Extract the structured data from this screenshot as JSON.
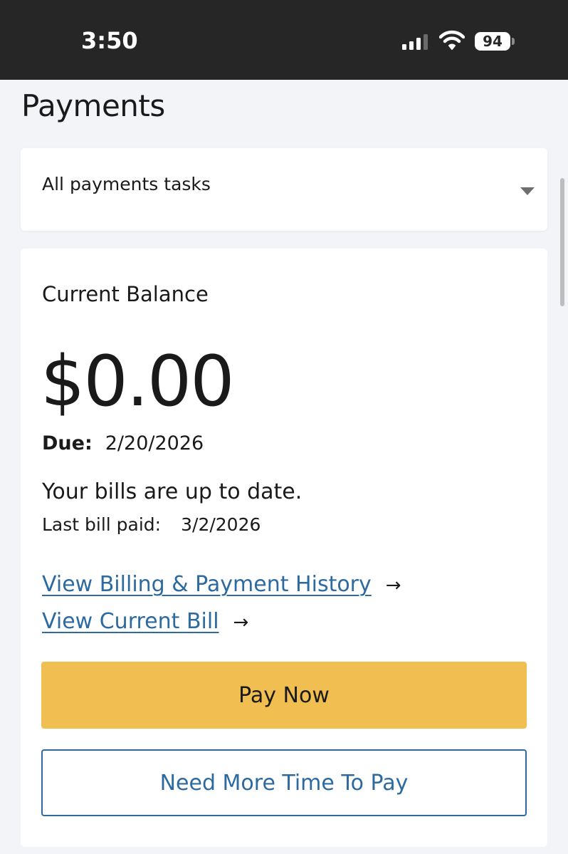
{
  "status_bar": {
    "time": "3:50",
    "battery": "94",
    "icons": [
      "signal-icon",
      "wifi-icon",
      "battery-icon"
    ]
  },
  "page": {
    "title": "Payments"
  },
  "task_select": {
    "selected": "All payments tasks"
  },
  "balance_card": {
    "heading": "Current Balance",
    "amount": "$0.00",
    "due_label": "Due:",
    "due_value": "2/20/2026",
    "status_message": "Your bills are up to date.",
    "last_paid_label": "Last bill paid:",
    "last_paid_value": "3/2/2026",
    "links": [
      {
        "label": "View Billing & Payment History",
        "icon": "arrow-right-icon",
        "arrow": "→"
      },
      {
        "label": "View Current Bill",
        "icon": "arrow-right-icon",
        "arrow": "→"
      }
    ],
    "pay_now_label": "Pay Now",
    "more_time_label": "Need More Time To Pay"
  },
  "colors": {
    "status_bar": "#262626",
    "background": "#f3f4f8",
    "accent_yellow": "#f0be51",
    "link_blue": "#2c6aa0"
  }
}
